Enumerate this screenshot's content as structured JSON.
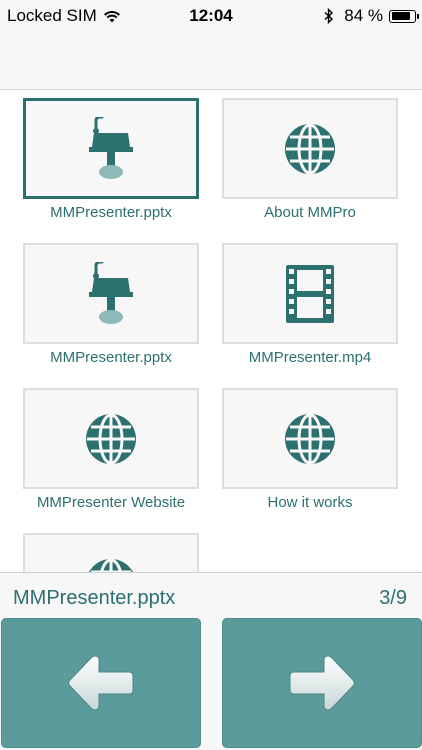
{
  "status_bar": {
    "carrier": "Locked SIM",
    "time": "12:04",
    "battery_percent": "84 %",
    "battery_level": 0.84
  },
  "tiles": [
    {
      "label": "MMPresenter.pptx",
      "icon": "presentation-icon",
      "selected": true
    },
    {
      "label": "About MMPro",
      "icon": "globe-icon",
      "selected": false
    },
    {
      "label": "MMPresenter.pptx",
      "icon": "presentation-icon",
      "selected": false
    },
    {
      "label": "MMPresenter.mp4",
      "icon": "film-icon",
      "selected": false
    },
    {
      "label": "MMPresenter Website",
      "icon": "globe-icon",
      "selected": false
    },
    {
      "label": "How it works",
      "icon": "globe-icon",
      "selected": false
    },
    {
      "label": "",
      "icon": "globe-icon",
      "selected": false
    }
  ],
  "info_bar": {
    "current_file": "MMPresenter.pptx",
    "page_counter": "3/9"
  },
  "buttons": {
    "previous_icon": "arrow-left-icon",
    "next_icon": "arrow-right-icon"
  },
  "colors": {
    "accent": "#2d7070",
    "button": "#5c9b9b",
    "tile_bg": "#f7f7f7",
    "tile_border": "#dedede"
  }
}
